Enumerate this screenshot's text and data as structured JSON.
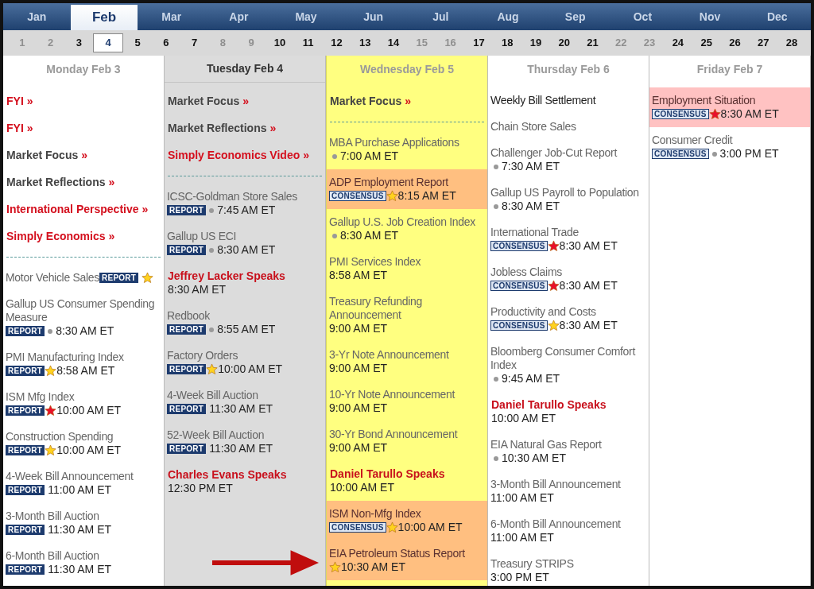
{
  "months": [
    {
      "label": "Jan",
      "selected": false
    },
    {
      "label": "Feb",
      "selected": true
    },
    {
      "label": "Mar",
      "selected": false
    },
    {
      "label": "Apr",
      "selected": false
    },
    {
      "label": "May",
      "selected": false
    },
    {
      "label": "Jun",
      "selected": false
    },
    {
      "label": "Jul",
      "selected": false
    },
    {
      "label": "Aug",
      "selected": false
    },
    {
      "label": "Sep",
      "selected": false
    },
    {
      "label": "Oct",
      "selected": false
    },
    {
      "label": "Nov",
      "selected": false
    },
    {
      "label": "Dec",
      "selected": false
    }
  ],
  "days": [
    {
      "label": "1",
      "muted": true,
      "selected": false
    },
    {
      "label": "2",
      "muted": true,
      "selected": false
    },
    {
      "label": "3",
      "muted": false,
      "selected": false
    },
    {
      "label": "4",
      "muted": false,
      "selected": true
    },
    {
      "label": "5",
      "muted": false,
      "selected": false
    },
    {
      "label": "6",
      "muted": false,
      "selected": false
    },
    {
      "label": "7",
      "muted": false,
      "selected": false
    },
    {
      "label": "8",
      "muted": true,
      "selected": false
    },
    {
      "label": "9",
      "muted": true,
      "selected": false
    },
    {
      "label": "10",
      "muted": false,
      "selected": false
    },
    {
      "label": "11",
      "muted": false,
      "selected": false
    },
    {
      "label": "12",
      "muted": false,
      "selected": false
    },
    {
      "label": "13",
      "muted": false,
      "selected": false
    },
    {
      "label": "14",
      "muted": false,
      "selected": false
    },
    {
      "label": "15",
      "muted": true,
      "selected": false
    },
    {
      "label": "16",
      "muted": true,
      "selected": false
    },
    {
      "label": "17",
      "muted": false,
      "selected": false
    },
    {
      "label": "18",
      "muted": false,
      "selected": false
    },
    {
      "label": "19",
      "muted": false,
      "selected": false
    },
    {
      "label": "20",
      "muted": false,
      "selected": false
    },
    {
      "label": "21",
      "muted": false,
      "selected": false
    },
    {
      "label": "22",
      "muted": true,
      "selected": false
    },
    {
      "label": "23",
      "muted": true,
      "selected": false
    },
    {
      "label": "24",
      "muted": false,
      "selected": false
    },
    {
      "label": "25",
      "muted": false,
      "selected": false
    },
    {
      "label": "26",
      "muted": false,
      "selected": false
    },
    {
      "label": "27",
      "muted": false,
      "selected": false
    },
    {
      "label": "28",
      "muted": false,
      "selected": false
    }
  ],
  "columns": [
    {
      "header": "Monday Feb 3",
      "selected": false,
      "today": false,
      "items": [
        {
          "kind": "feature",
          "label": "FYI",
          "arrow": "»",
          "red": true
        },
        {
          "kind": "feature",
          "label": "FYI",
          "arrow": "»",
          "red": true
        },
        {
          "kind": "feature",
          "label": "Market Focus",
          "arrow": "»",
          "red": false
        },
        {
          "kind": "feature",
          "label": "Market Reflections",
          "arrow": "»",
          "red": false
        },
        {
          "kind": "feature",
          "label": "International Perspective",
          "arrow": "»",
          "red": true
        },
        {
          "kind": "feature",
          "label": "Simply Economics",
          "arrow": "»",
          "red": true
        },
        {
          "kind": "divider"
        },
        {
          "kind": "event",
          "title": "Motor Vehicle Sales",
          "tag": "REPORT",
          "marker": {
            "kind": "star",
            "color": "#ffd21f"
          },
          "inline": true
        },
        {
          "kind": "event",
          "title": "Gallup US Consumer Spending Measure",
          "tag": "REPORT",
          "marker": {
            "kind": "dot",
            "color": "#999999"
          },
          "time": "8:30 AM ET"
        },
        {
          "kind": "event",
          "title": "PMI Manufacturing Index",
          "tag": "REPORT",
          "marker": {
            "kind": "star",
            "color": "#ffd21f"
          },
          "time": "8:58 AM ET"
        },
        {
          "kind": "event",
          "title": "ISM Mfg Index",
          "tag": "REPORT",
          "marker": {
            "kind": "star",
            "color": "#e8102a"
          },
          "time": "10:00 AM ET"
        },
        {
          "kind": "event",
          "title": "Construction Spending",
          "tag": "REPORT",
          "marker": {
            "kind": "star",
            "color": "#ffd21f"
          },
          "time": "10:00 AM ET"
        },
        {
          "kind": "event",
          "title": "4-Week Bill Announcement",
          "tag": "REPORT",
          "time": "11:00 AM ET"
        },
        {
          "kind": "event",
          "title": "3-Month Bill Auction",
          "tag": "REPORT",
          "time": "11:30 AM ET"
        },
        {
          "kind": "event",
          "title": "6-Month Bill Auction",
          "tag": "REPORT",
          "time": "11:30 AM ET"
        }
      ]
    },
    {
      "header": "Tuesday Feb 4",
      "selected": true,
      "today": false,
      "items": [
        {
          "kind": "feature",
          "label": "Market Focus",
          "arrow": "»",
          "red": false
        },
        {
          "kind": "feature",
          "label": "Market Reflections",
          "arrow": "»",
          "red": false
        },
        {
          "kind": "feature",
          "label": "Simply Economics Video",
          "arrow": "»",
          "red": true
        },
        {
          "kind": "divider"
        },
        {
          "kind": "event",
          "title": "ICSC-Goldman Store Sales",
          "tag": "REPORT",
          "marker": {
            "kind": "dot",
            "color": "#999999"
          },
          "time": "7:45 AM ET"
        },
        {
          "kind": "event",
          "title": "Gallup US ECI",
          "tag": "REPORT",
          "marker": {
            "kind": "dot",
            "color": "#999999"
          },
          "time": "8:30 AM ET"
        },
        {
          "kind": "speech",
          "title": "Jeffrey Lacker Speaks",
          "time": "8:30 AM ET"
        },
        {
          "kind": "event",
          "title": "Redbook",
          "tag": "REPORT",
          "marker": {
            "kind": "dot",
            "color": "#999999"
          },
          "time": "8:55 AM ET"
        },
        {
          "kind": "event",
          "title": "Factory Orders",
          "tag": "REPORT",
          "marker": {
            "kind": "star",
            "color": "#ffd21f"
          },
          "time": "10:00 AM ET"
        },
        {
          "kind": "event",
          "title": "4-Week Bill Auction",
          "tag": "REPORT",
          "time": "11:30 AM ET"
        },
        {
          "kind": "event",
          "title": "52-Week Bill Auction",
          "tag": "REPORT",
          "time": "11:30 AM ET"
        },
        {
          "kind": "speech",
          "title": "Charles Evans Speaks",
          "time": "12:30 PM ET"
        }
      ]
    },
    {
      "header": "Wednesday Feb 5",
      "selected": false,
      "today": true,
      "items": [
        {
          "kind": "feature",
          "label": "Market Focus",
          "arrow": "»",
          "red": false
        },
        {
          "kind": "divider"
        },
        {
          "kind": "event",
          "title": "MBA Purchase Applications",
          "marker": {
            "kind": "dot",
            "color": "#999999"
          },
          "time": "7:00 AM ET"
        },
        {
          "kind": "event",
          "title": "ADP Employment Report",
          "tag": "CONSENSUS",
          "marker": {
            "kind": "star",
            "color": "#ffd21f"
          },
          "time": "8:15 AM ET",
          "color": "#ffbf80"
        },
        {
          "kind": "event",
          "title": "Gallup U.S. Job Creation Index",
          "marker": {
            "kind": "dot",
            "color": "#999999"
          },
          "time": "8:30 AM ET"
        },
        {
          "kind": "event",
          "title": "PMI Services Index",
          "time": "8:58 AM ET"
        },
        {
          "kind": "event",
          "title": "Treasury Refunding Announcement",
          "time": "9:00 AM ET"
        },
        {
          "kind": "event",
          "title": "3-Yr Note Announcement",
          "time": "9:00 AM ET"
        },
        {
          "kind": "event",
          "title": "10-Yr Note Announcement",
          "time": "9:00 AM ET"
        },
        {
          "kind": "event",
          "title": "30-Yr Bond Announcement",
          "time": "9:00 AM ET"
        },
        {
          "kind": "speech",
          "title": "Daniel Tarullo Speaks",
          "time": "10:00 AM ET"
        },
        {
          "kind": "event",
          "title": "ISM Non-Mfg Index",
          "tag": "CONSENSUS",
          "marker": {
            "kind": "star",
            "color": "#ffd21f"
          },
          "time": "10:00 AM ET",
          "color": "#ffbf80"
        },
        {
          "kind": "event",
          "title": "EIA Petroleum Status Report",
          "marker": {
            "kind": "star",
            "color": "#ffd21f"
          },
          "time": "10:30 AM ET",
          "color": "#ffbf80"
        }
      ]
    },
    {
      "header": "Thursday Feb 6",
      "selected": false,
      "today": false,
      "items": [
        {
          "kind": "event",
          "title": "Weekly Bill Settlement",
          "dark": true
        },
        {
          "kind": "event",
          "title": "Chain Store Sales"
        },
        {
          "kind": "event",
          "title": "Challenger Job-Cut Report",
          "marker": {
            "kind": "dot",
            "color": "#999999"
          },
          "time": "7:30 AM ET"
        },
        {
          "kind": "event",
          "title": "Gallup US Payroll to Population",
          "marker": {
            "kind": "dot",
            "color": "#999999"
          },
          "time": "8:30 AM ET"
        },
        {
          "kind": "event",
          "title": "International Trade",
          "tag": "CONSENSUS",
          "marker": {
            "kind": "star",
            "color": "#e8102a"
          },
          "time": "8:30 AM ET"
        },
        {
          "kind": "event",
          "title": "Jobless Claims",
          "tag": "CONSENSUS",
          "marker": {
            "kind": "star",
            "color": "#e8102a"
          },
          "time": "8:30 AM ET"
        },
        {
          "kind": "event",
          "title": "Productivity and Costs",
          "tag": "CONSENSUS",
          "marker": {
            "kind": "star",
            "color": "#ffd21f"
          },
          "time": "8:30 AM ET"
        },
        {
          "kind": "event",
          "title": "Bloomberg Consumer Comfort Index",
          "marker": {
            "kind": "dot",
            "color": "#999999"
          },
          "time": "9:45 AM ET"
        },
        {
          "kind": "speech",
          "title": "Daniel Tarullo Speaks",
          "time": "10:00 AM ET"
        },
        {
          "kind": "event",
          "title": "EIA Natural Gas Report",
          "marker": {
            "kind": "dot",
            "color": "#999999"
          },
          "time": "10:30 AM ET"
        },
        {
          "kind": "event",
          "title": "3-Month Bill Announcement",
          "time": "11:00 AM ET"
        },
        {
          "kind": "event",
          "title": "6-Month Bill Announcement",
          "time": "11:00 AM ET"
        },
        {
          "kind": "event",
          "title": "Treasury STRIPS",
          "time": "3:00 PM ET"
        }
      ]
    },
    {
      "header": "Friday Feb 7",
      "selected": false,
      "today": false,
      "items": [
        {
          "kind": "event",
          "title": "Employment Situation",
          "tag": "CONSENSUS",
          "marker": {
            "kind": "star",
            "color": "#e8102a"
          },
          "time": "8:30 AM ET",
          "color": "#ffc2c2"
        },
        {
          "kind": "event",
          "title": "Consumer Credit",
          "tag": "CONSENSUS",
          "marker": {
            "kind": "dot",
            "color": "#999999"
          },
          "time": "3:00 PM ET"
        }
      ]
    }
  ]
}
